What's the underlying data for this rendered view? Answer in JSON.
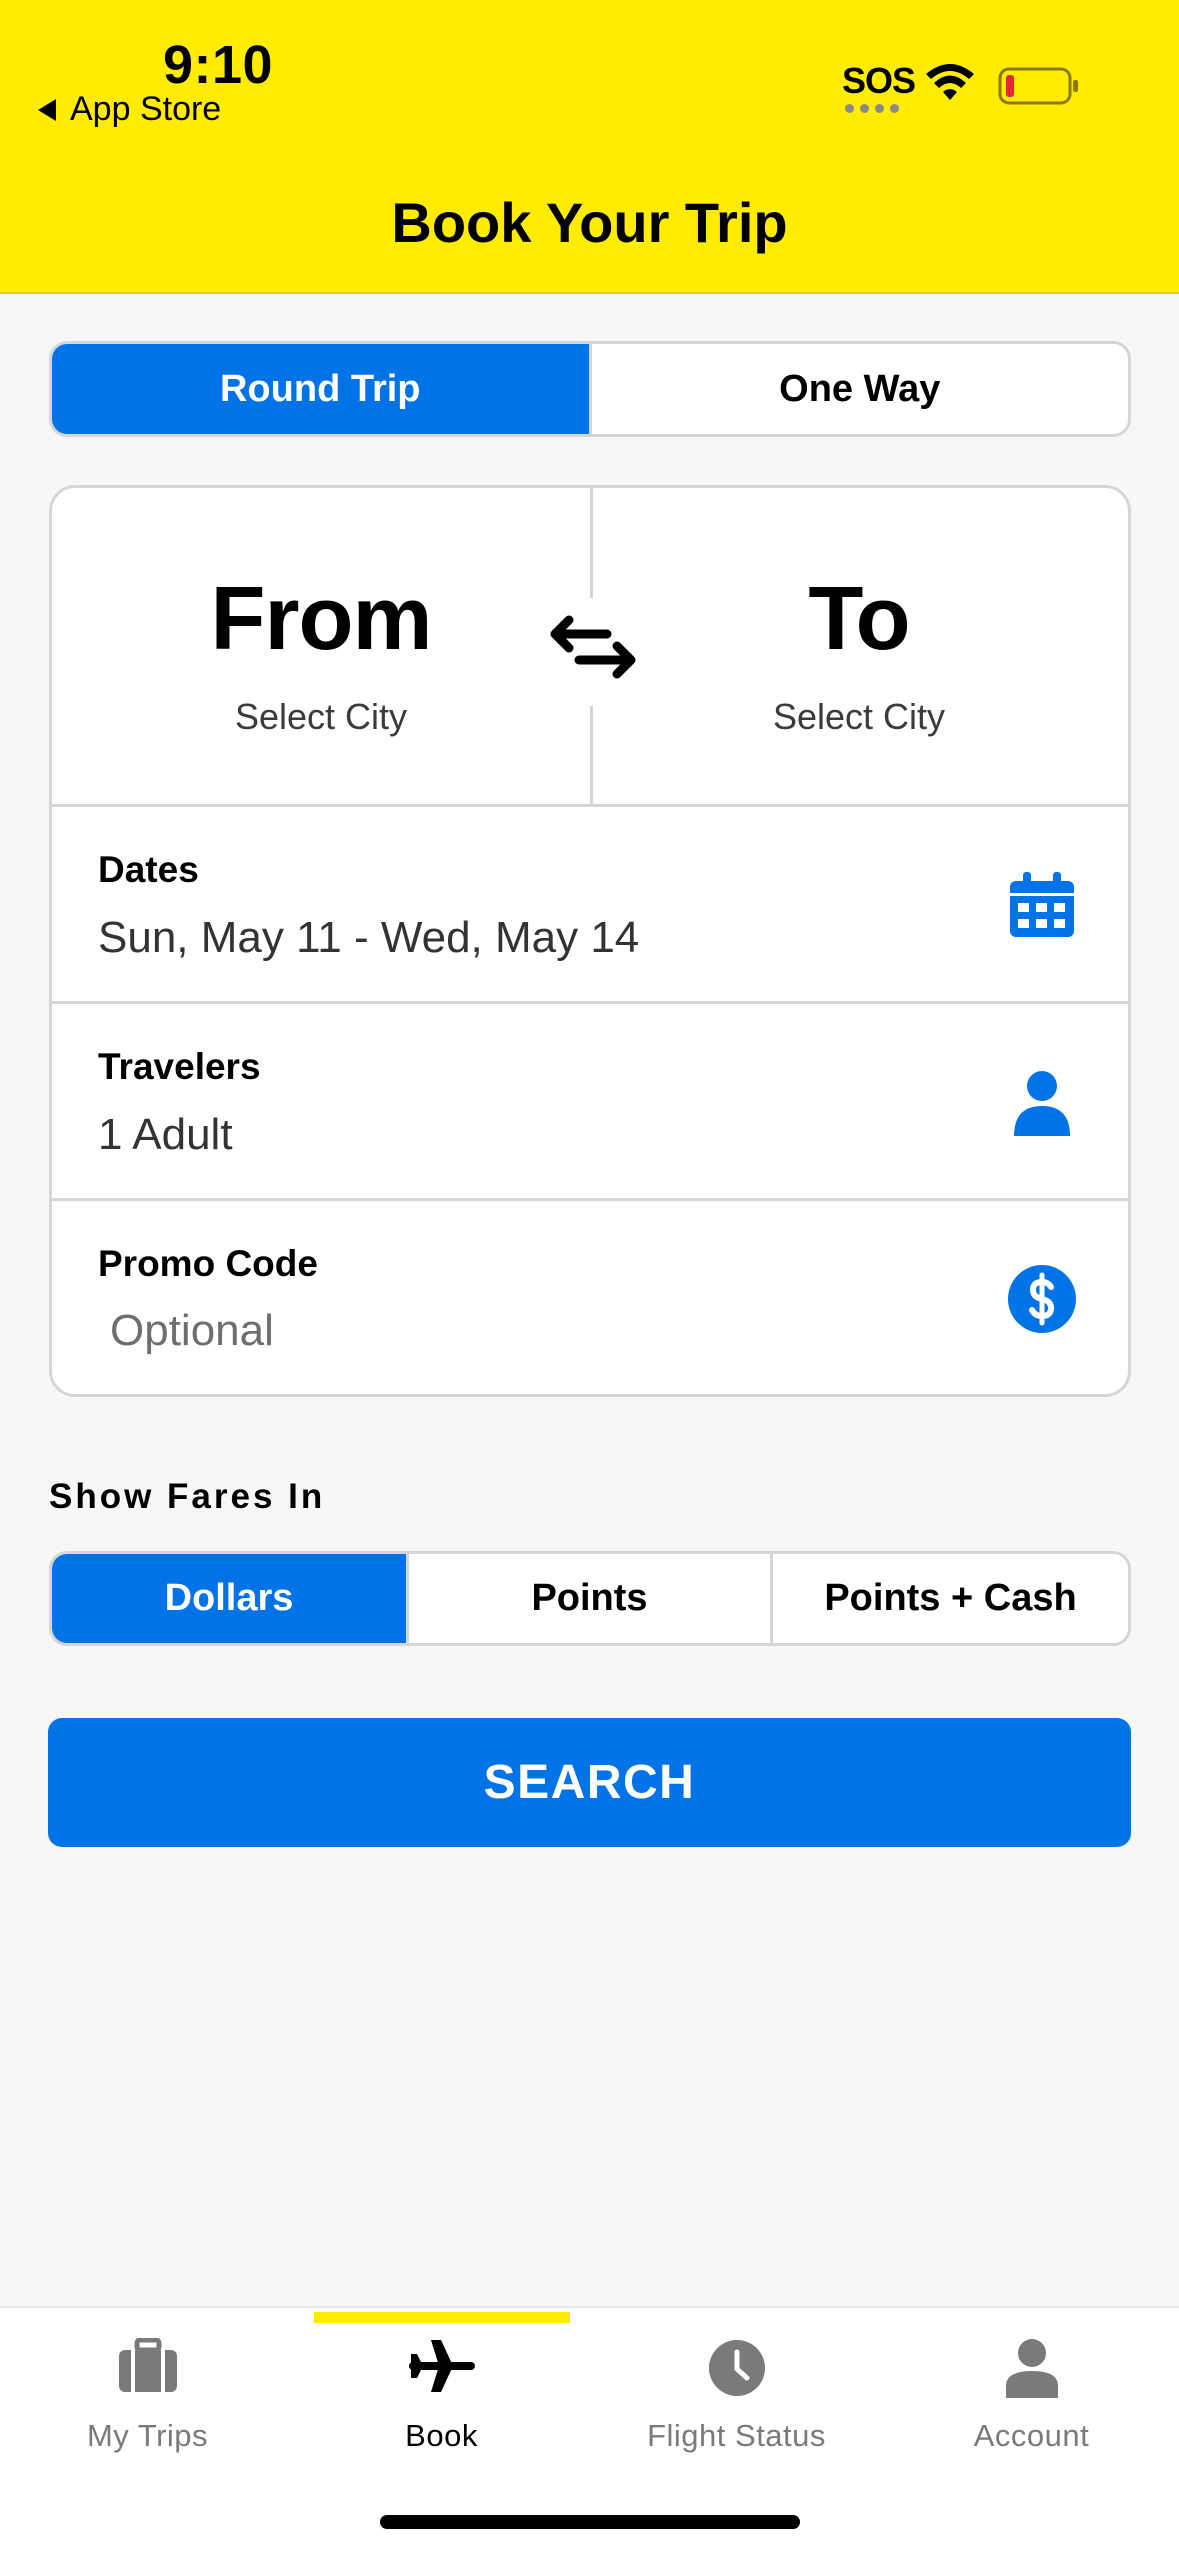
{
  "status_bar": {
    "time": "9:10",
    "back_label": "App Store",
    "sos": "SOS",
    "battery_level": 0.1
  },
  "header": {
    "title": "Book Your Trip",
    "background_color": "#ffec00"
  },
  "trip_type": {
    "options": [
      "Round Trip",
      "One Way"
    ],
    "selected": "Round Trip"
  },
  "route": {
    "from_label": "From",
    "from_value": "Select City",
    "to_label": "To",
    "to_value": "Select City",
    "swap_icon": "swap-arrows-icon"
  },
  "dates": {
    "label": "Dates",
    "value": "Sun, May 11 - Wed, May 14",
    "icon": "calendar-icon"
  },
  "travelers": {
    "label": "Travelers",
    "value": "1 Adult",
    "icon": "person-icon"
  },
  "promo": {
    "label": "Promo Code",
    "placeholder": "Optional",
    "value": "",
    "icon": "dollar-circle-icon"
  },
  "fares": {
    "heading": "Show Fares In",
    "options": [
      "Dollars",
      "Points",
      "Points + Cash"
    ],
    "selected": "Dollars"
  },
  "search_label": "SEARCH",
  "tabbar": {
    "items": [
      {
        "label": "My Trips",
        "icon": "suitcase-icon"
      },
      {
        "label": "Book",
        "icon": "airplane-icon"
      },
      {
        "label": "Flight Status",
        "icon": "clock-icon"
      },
      {
        "label": "Account",
        "icon": "person-icon"
      }
    ],
    "active": "Book"
  },
  "colors": {
    "accent": "#0073e6",
    "brand_yellow": "#ffec00"
  }
}
